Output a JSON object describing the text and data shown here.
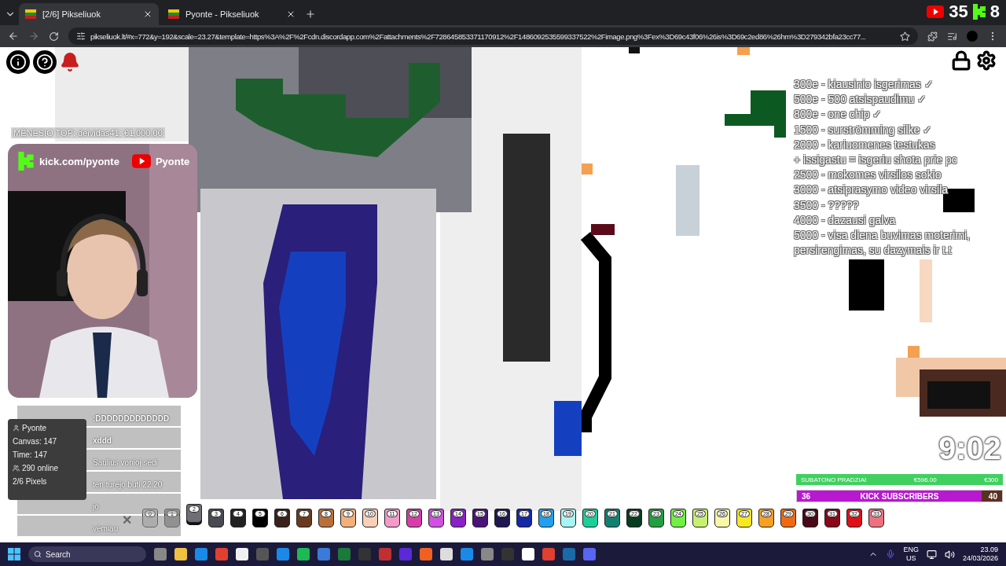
{
  "browser": {
    "tabs": [
      {
        "label": "[2/6] Pikseliuok",
        "selected": true
      },
      {
        "label": "Pyonte - Pikseliuok",
        "selected": false
      }
    ],
    "url": "pikseliuok.lt/#x=772&y=192&scale=23.27&template=https%3A%2F%2Fcdn.discordapp.com%2Fattachments%2F728645853371170912%2F1486092535599337522%2Fimage.png%3Fex%3D69c43f06%26is%3D69c2ed86%26hm%3D279342bfa23cc77..."
  },
  "viewers": [
    {
      "kind": "youtube",
      "value": "35"
    },
    {
      "kind": "kick",
      "value": "8"
    }
  ],
  "top_donor": "MĖNESIO TOP: deividas41: €1,000.00",
  "webcam": {
    "kick_link": "kick.com/pyonte",
    "youtube_name": "Pyonte"
  },
  "goals": [
    "300e - kiausinio isgerimas ✓",
    "500e - 500 atsispaudimu ✓",
    "800e - one chip ✓",
    "1500 - surströmming silke ✓",
    "2000 - kariuomenes testukas",
    "+ issigastu = isgeriu shota prie pc",
    "2500 - mokomes virsilos sokio",
    "3000 - atsiprasymo video virsila",
    "3500 - ?????",
    "4000 - dazausi galva",
    "5000 - visa diena buvimas moterimi,",
    "persirengimas, su dazymais ir t.t"
  ],
  "timer": "9:02",
  "donation_bar": {
    "title": "SUBATONO PRADZIAI",
    "raised": "€596.00",
    "goal": "€300"
  },
  "subscriber_bar": {
    "current": "36",
    "title": "KICK SUBSCRIBERS",
    "target": "40",
    "level": 0.9
  },
  "stats": [
    "Pyonte",
    "Canvas: 147",
    "Time: 147",
    "290 online",
    "2/6 Pixels"
  ],
  "chat": [
    ":DDDDDDDDDDDDD",
    "xddd",
    "Saulius vonioj sėdi",
    "ten turėjo buti 22:20",
    "jo",
    "vėmiau"
  ],
  "palette": {
    "close": "✕",
    "colors": [
      {
        "label": "0",
        "color": "#d0d0d0",
        "selected": false
      },
      {
        "label": "1",
        "color": "#8a8a8a",
        "selected": false
      },
      {
        "label": "2",
        "color": "#6e6e76",
        "selected": true
      },
      {
        "label": "3",
        "color": "#4a4a52",
        "selected": false
      },
      {
        "label": "4",
        "color": "#222222",
        "selected": false
      },
      {
        "label": "5",
        "color": "#000000",
        "selected": false
      },
      {
        "label": "6",
        "color": "#3a2218",
        "selected": false
      },
      {
        "label": "7",
        "color": "#6b3a1e",
        "selected": false
      },
      {
        "label": "8",
        "color": "#b8703a",
        "selected": false
      },
      {
        "label": "9",
        "color": "#f4b07a",
        "selected": false
      },
      {
        "label": "10",
        "color": "#f8d0b8",
        "selected": false
      },
      {
        "label": "11",
        "color": "#f49ac8",
        "selected": false
      },
      {
        "label": "12",
        "color": "#d83ca8",
        "selected": false
      },
      {
        "label": "13",
        "color": "#d050e0",
        "selected": false
      },
      {
        "label": "14",
        "color": "#8a20c8",
        "selected": false
      },
      {
        "label": "15",
        "color": "#4a1478",
        "selected": false
      },
      {
        "label": "16",
        "color": "#1e1850",
        "selected": false
      },
      {
        "label": "17",
        "color": "#1428a8",
        "selected": false
      },
      {
        "label": "18",
        "color": "#20a0f0",
        "selected": false
      },
      {
        "label": "19",
        "color": "#a8f4f4",
        "selected": false
      },
      {
        "label": "20",
        "color": "#18d098",
        "selected": false
      },
      {
        "label": "21",
        "color": "#108070",
        "selected": false
      },
      {
        "label": "22",
        "color": "#083c20",
        "selected": false
      },
      {
        "label": "23",
        "color": "#20a040",
        "selected": false
      },
      {
        "label": "24",
        "color": "#70f040",
        "selected": false
      },
      {
        "label": "25",
        "color": "#c8f070",
        "selected": false
      },
      {
        "label": "26",
        "color": "#f8f8a8",
        "selected": false
      },
      {
        "label": "27",
        "color": "#f8e820",
        "selected": false
      },
      {
        "label": "28",
        "color": "#f8a020",
        "selected": false
      },
      {
        "label": "29",
        "color": "#f06a10",
        "selected": false
      },
      {
        "label": "30",
        "color": "#4a0818",
        "selected": false
      },
      {
        "label": "31",
        "color": "#8a0818",
        "selected": false
      },
      {
        "label": "32",
        "color": "#e01018",
        "selected": false
      },
      {
        "label": "33",
        "color": "#f07080",
        "selected": false
      }
    ]
  },
  "taskbar": {
    "search_placeholder": "Search",
    "language": "ENG",
    "region": "US",
    "time": "23.09",
    "date": "24/03/2026"
  }
}
